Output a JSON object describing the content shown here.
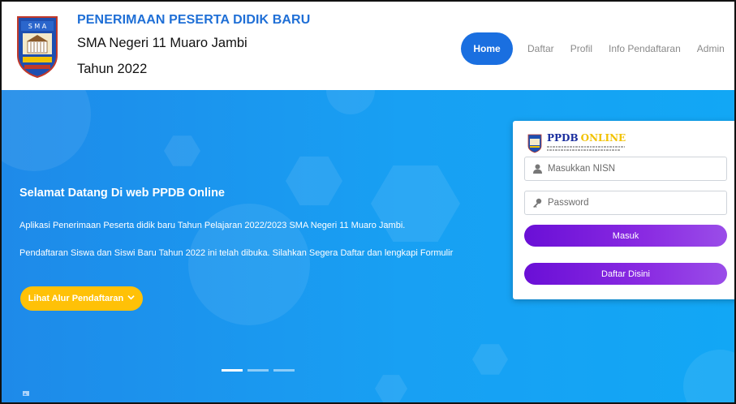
{
  "header": {
    "logo_name": "sma-crest-logo",
    "title": "PENERIMAAN PESERTA DIDIK BARU",
    "school": "SMA Negeri 11 Muaro Jambi",
    "year": "Tahun 2022"
  },
  "nav": {
    "items": [
      "Home",
      "Daftar",
      "Profil",
      "Info Pendaftaran",
      "Admin"
    ],
    "active": "Home"
  },
  "hero": {
    "title": "Selamat Datang Di web PPDB Online",
    "line1": "Aplikasi Penerimaan Peserta didik baru Tahun Pelajaran 2022/2023 SMA Negeri 11 Muaro Jambi.",
    "line2": "Pendaftaran Siswa dan Siswi Baru Tahun 2022 ini telah dibuka. Silahkan Segera Daftar dan lengkapi Formulir",
    "cta_label": "Lihat Alur Pendaftaran",
    "cta_icon": "chevron-down-icon",
    "slides_total": 3,
    "slide_active": 1
  },
  "login": {
    "brand_word1": "PPDB",
    "brand_word2": "ONLINE",
    "nisn_placeholder": "Masukkan NISN",
    "nisn_icon": "user-icon",
    "password_placeholder": "Password",
    "password_icon": "key-icon",
    "submit_label": "Masuk",
    "register_label": "Daftar Disini"
  },
  "colors": {
    "brand_blue": "#1f6fd6",
    "nav_active": "#1a6fe0",
    "hero_bg": "#1e8ae9",
    "cta_yellow": "#ffc107",
    "button_purple": "#7b1fe0"
  }
}
